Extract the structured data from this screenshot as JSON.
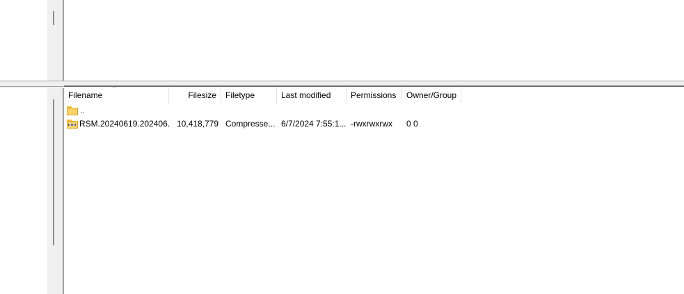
{
  "file_list": {
    "columns": {
      "filename": "Filename",
      "filesize": "Filesize",
      "filetype": "Filetype",
      "last_modified": "Last modified",
      "permissions": "Permissions",
      "owner_group": "Owner/Group"
    },
    "sort_indicator": "^",
    "rows": [
      {
        "icon": "folder-icon",
        "filename": "..",
        "filesize": "",
        "filetype": "",
        "last_modified": "",
        "permissions": "",
        "owner_group": ""
      },
      {
        "icon": "compressed-folder-icon",
        "filename": "RSM.20240619.202406...",
        "filesize": "10,418,779",
        "filetype": "Compresse...",
        "last_modified": "6/7/2024 7:55:1...",
        "permissions": "-rwxrwxrwx",
        "owner_group": "0 0"
      }
    ]
  }
}
